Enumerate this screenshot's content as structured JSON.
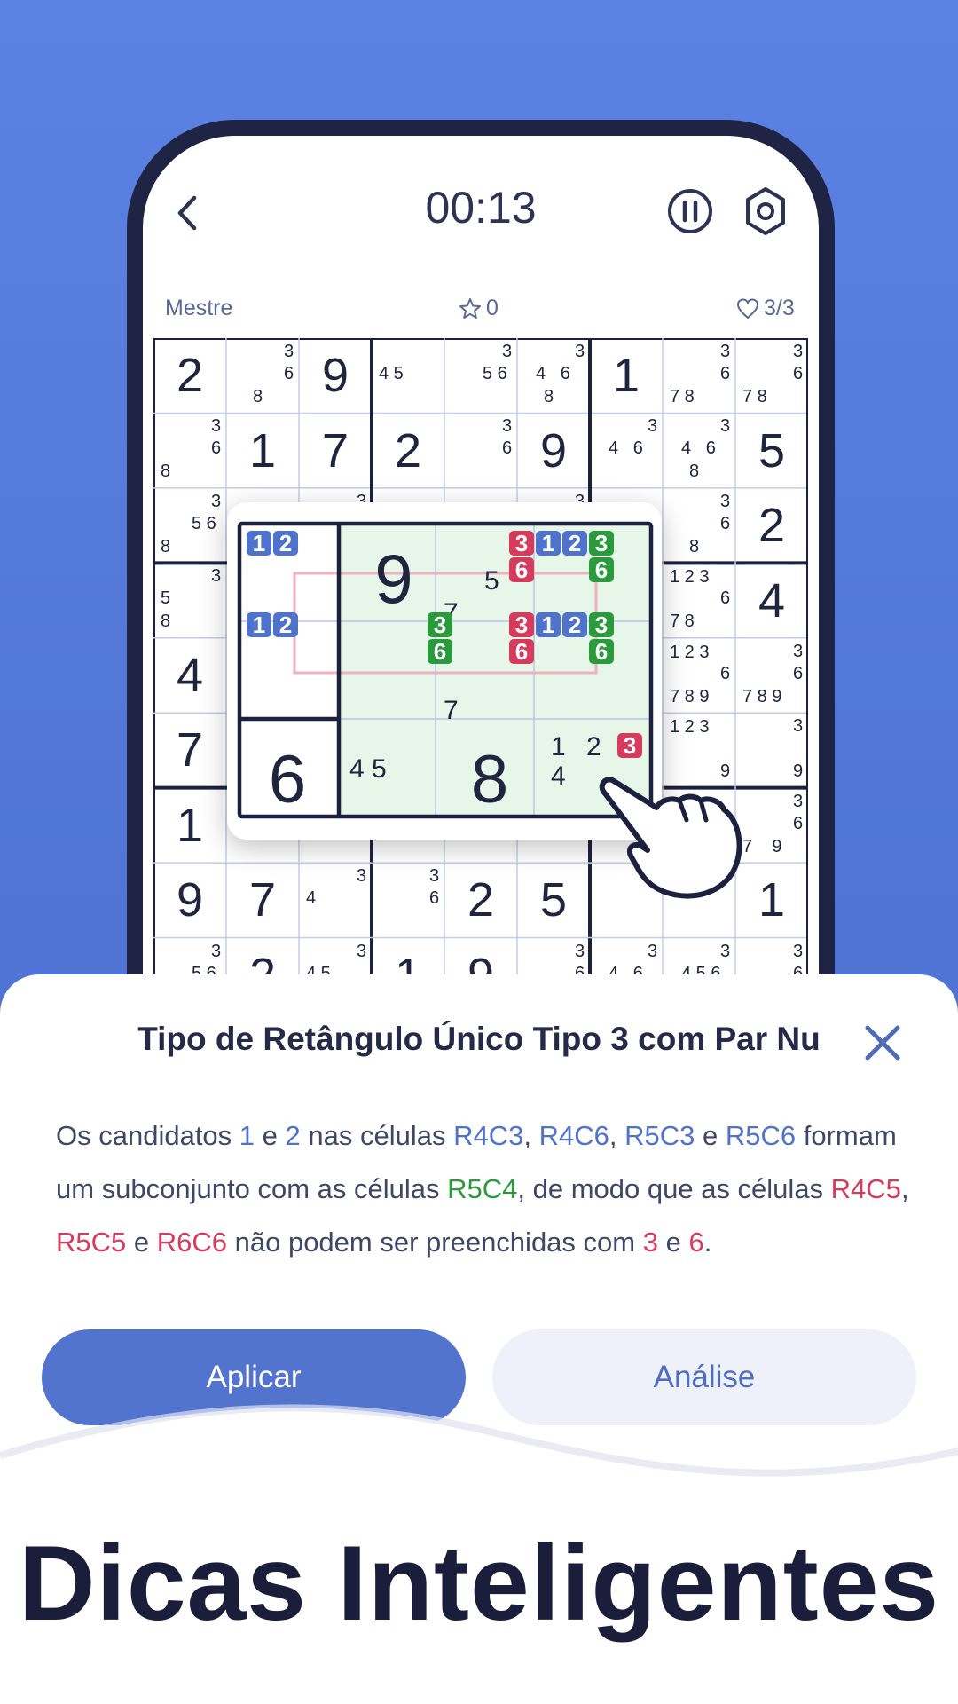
{
  "topbar": {
    "timer": "00:13"
  },
  "info": {
    "difficulty": "Mestre",
    "stars": "0",
    "lives": "3/3"
  },
  "board": {
    "big": [
      [
        "2",
        "",
        "9",
        "",
        "",
        "",
        "1",
        "",
        ""
      ],
      [
        "",
        "1",
        "7",
        "2",
        "",
        "9",
        "",
        "",
        "5"
      ],
      [
        "",
        "",
        "",
        "",
        "",
        "",
        "",
        "",
        "2"
      ],
      [
        "",
        "",
        "",
        "",
        "",
        "",
        "",
        "",
        "4"
      ],
      [
        "4",
        "",
        "",
        "",
        "",
        "",
        "",
        "",
        ""
      ],
      [
        "7",
        "",
        "",
        "",
        "",
        "",
        "",
        "",
        ""
      ],
      [
        "1",
        "",
        "",
        "",
        "",
        "",
        "",
        "",
        ""
      ],
      [
        "9",
        "7",
        "",
        "",
        "2",
        "5",
        "",
        "",
        "1"
      ],
      [
        "",
        "2",
        "",
        "1",
        "9",
        "",
        "",
        "",
        ""
      ]
    ],
    "notes": [
      [
        {
          "r": 0,
          "c": 1,
          "t": "3",
          "p": "tr"
        },
        {
          "r": 0,
          "c": 1,
          "t": "6",
          "p": "mr"
        },
        {
          "r": 0,
          "c": 1,
          "t": "8",
          "p": "bc"
        },
        {
          "r": 0,
          "c": 3,
          "t": "4 5",
          "p": "ml"
        },
        {
          "r": 0,
          "c": 4,
          "t": "3",
          "p": "tr"
        },
        {
          "r": 0,
          "c": 4,
          "t": "5 6",
          "p": "mr"
        },
        {
          "r": 0,
          "c": 5,
          "t": "3",
          "p": "tr"
        },
        {
          "r": 0,
          "c": 5,
          "t": "4   6",
          "p": "mr"
        },
        {
          "r": 0,
          "c": 5,
          "t": "8",
          "p": "bc"
        },
        {
          "r": 0,
          "c": 7,
          "t": "3",
          "p": "tr"
        },
        {
          "r": 0,
          "c": 7,
          "t": "6",
          "p": "mr"
        },
        {
          "r": 0,
          "c": 7,
          "t": "7 8",
          "p": "bl"
        },
        {
          "r": 0,
          "c": 8,
          "t": "3",
          "p": "tr"
        },
        {
          "r": 0,
          "c": 8,
          "t": "6",
          "p": "mr"
        },
        {
          "r": 0,
          "c": 8,
          "t": "7 8",
          "p": "bl"
        }
      ],
      [
        {
          "r": 1,
          "c": 0,
          "t": "3",
          "p": "tr"
        },
        {
          "r": 1,
          "c": 0,
          "t": "6",
          "p": "mr"
        },
        {
          "r": 1,
          "c": 0,
          "t": "8",
          "p": "bl"
        },
        {
          "r": 1,
          "c": 4,
          "t": "3",
          "p": "tr"
        },
        {
          "r": 1,
          "c": 4,
          "t": "6",
          "p": "mr"
        },
        {
          "r": 1,
          "c": 6,
          "t": "3",
          "p": "tr"
        },
        {
          "r": 1,
          "c": 6,
          "t": "4   6",
          "p": "mr"
        },
        {
          "r": 1,
          "c": 7,
          "t": "3",
          "p": "tr"
        },
        {
          "r": 1,
          "c": 7,
          "t": "4   6",
          "p": "mr"
        },
        {
          "r": 1,
          "c": 7,
          "t": "8",
          "p": "bc"
        }
      ],
      [
        {
          "r": 2,
          "c": 0,
          "t": "3",
          "p": "tr"
        },
        {
          "r": 2,
          "c": 0,
          "t": "5 6",
          "p": "mr"
        },
        {
          "r": 2,
          "c": 0,
          "t": "8",
          "p": "bl"
        },
        {
          "r": 2,
          "c": 2,
          "t": "3",
          "p": "tr"
        },
        {
          "r": 2,
          "c": 5,
          "t": "3",
          "p": "tr"
        },
        {
          "r": 2,
          "c": 7,
          "t": "3",
          "p": "tr"
        },
        {
          "r": 2,
          "c": 7,
          "t": "6",
          "p": "mr"
        },
        {
          "r": 2,
          "c": 7,
          "t": "8",
          "p": "bc"
        }
      ],
      [
        {
          "r": 3,
          "c": 0,
          "t": "3",
          "p": "tr"
        },
        {
          "r": 3,
          "c": 0,
          "t": "5",
          "p": "ml"
        },
        {
          "r": 3,
          "c": 0,
          "t": "8",
          "p": "bl"
        },
        {
          "r": 3,
          "c": 7,
          "t": "1 2 3",
          "p": "tl"
        },
        {
          "r": 3,
          "c": 7,
          "t": "6",
          "p": "mr"
        },
        {
          "r": 3,
          "c": 7,
          "t": "7 8",
          "p": "bl"
        }
      ],
      [
        {
          "r": 4,
          "c": 7,
          "t": "1 2 3",
          "p": "tl"
        },
        {
          "r": 4,
          "c": 7,
          "t": "6",
          "p": "mr"
        },
        {
          "r": 4,
          "c": 7,
          "t": "7 8 9",
          "p": "bl"
        },
        {
          "r": 4,
          "c": 8,
          "t": "3",
          "p": "tr"
        },
        {
          "r": 4,
          "c": 8,
          "t": "6",
          "p": "mr"
        },
        {
          "r": 4,
          "c": 8,
          "t": "7 8 9",
          "p": "bl"
        }
      ],
      [
        {
          "r": 5,
          "c": 7,
          "t": "1 2 3",
          "p": "tl"
        },
        {
          "r": 5,
          "c": 7,
          "t": "9",
          "p": "br"
        },
        {
          "r": 5,
          "c": 8,
          "t": "3",
          "p": "tr"
        },
        {
          "r": 5,
          "c": 8,
          "t": "9",
          "p": "br"
        }
      ],
      [
        {
          "r": 6,
          "c": 8,
          "t": "3",
          "p": "tr"
        },
        {
          "r": 6,
          "c": 8,
          "t": "6",
          "p": "mr"
        },
        {
          "r": 6,
          "c": 8,
          "t": "7    9",
          "p": "bl"
        }
      ],
      [
        {
          "r": 7,
          "c": 2,
          "t": "3",
          "p": "tr"
        },
        {
          "r": 7,
          "c": 2,
          "t": "4",
          "p": "ml"
        },
        {
          "r": 7,
          "c": 3,
          "t": "3",
          "p": "tr"
        },
        {
          "r": 7,
          "c": 3,
          "t": "6",
          "p": "mr"
        }
      ],
      [
        {
          "r": 8,
          "c": 0,
          "t": "3",
          "p": "tr"
        },
        {
          "r": 8,
          "c": 0,
          "t": "5 6",
          "p": "mr"
        },
        {
          "r": 8,
          "c": 2,
          "t": "3",
          "p": "tr"
        },
        {
          "r": 8,
          "c": 2,
          "t": "4 5",
          "p": "ml"
        },
        {
          "r": 8,
          "c": 5,
          "t": "3",
          "p": "tr"
        },
        {
          "r": 8,
          "c": 5,
          "t": "6",
          "p": "mr"
        },
        {
          "r": 8,
          "c": 6,
          "t": "3",
          "p": "tr"
        },
        {
          "r": 8,
          "c": 6,
          "t": "4   6",
          "p": "mr"
        },
        {
          "r": 8,
          "c": 7,
          "t": "3",
          "p": "tr"
        },
        {
          "r": 8,
          "c": 7,
          "t": "4 5 6",
          "p": "mr"
        },
        {
          "r": 8,
          "c": 8,
          "t": "3",
          "p": "tr"
        },
        {
          "r": 8,
          "c": 8,
          "t": "6",
          "p": "mr"
        }
      ]
    ]
  },
  "zoom": {
    "big": [
      "9",
      "6",
      "8"
    ],
    "notes": [
      "5",
      "7",
      "7",
      "4 5",
      "1",
      "2",
      "4"
    ],
    "badges_blue": [
      "1",
      "2",
      "1",
      "2",
      "1",
      "2",
      "1",
      "2"
    ],
    "badges_red": [
      "3",
      "6",
      "3",
      "6",
      "3"
    ],
    "badges_green": [
      "3",
      "6",
      "3",
      "6",
      "3",
      "6"
    ]
  },
  "sheet": {
    "title": "Tipo de Retângulo Único Tipo 3 com Par Nu",
    "p": [
      {
        "t": "Os candidatos ",
        "k": ""
      },
      {
        "t": "1",
        "k": "blue"
      },
      {
        "t": " e ",
        "k": ""
      },
      {
        "t": "2",
        "k": "blue"
      },
      {
        "t": " nas células ",
        "k": ""
      },
      {
        "t": "R4C3",
        "k": "blue"
      },
      {
        "t": ", ",
        "k": ""
      },
      {
        "t": "R4C6",
        "k": "blue"
      },
      {
        "t": ", ",
        "k": ""
      },
      {
        "t": "R5C3",
        "k": "blue"
      },
      {
        "t": " e ",
        "k": ""
      },
      {
        "t": "R5C6",
        "k": "blue"
      },
      {
        "t": " formam um subconjunto com as células ",
        "k": ""
      },
      {
        "t": "R5C4",
        "k": "green"
      },
      {
        "t": ", de modo que as células ",
        "k": ""
      },
      {
        "t": "R4C5",
        "k": "red"
      },
      {
        "t": ", ",
        "k": ""
      },
      {
        "t": "R5C5",
        "k": "red"
      },
      {
        "t": " e ",
        "k": ""
      },
      {
        "t": "R6C6",
        "k": "red"
      },
      {
        "t": " não podem ser preenchidas com ",
        "k": ""
      },
      {
        "t": "3",
        "k": "red"
      },
      {
        "t": " e ",
        "k": ""
      },
      {
        "t": "6",
        "k": "red"
      },
      {
        "t": ".",
        "k": ""
      }
    ],
    "apply_label": "Aplicar",
    "analyze_label": "Análise"
  },
  "headline": "Dicas Inteligentes",
  "colors": {
    "blue": "#4f73cb",
    "red": "#d63a5d",
    "green": "#2a9a3c",
    "bg": "#5b82e3"
  }
}
